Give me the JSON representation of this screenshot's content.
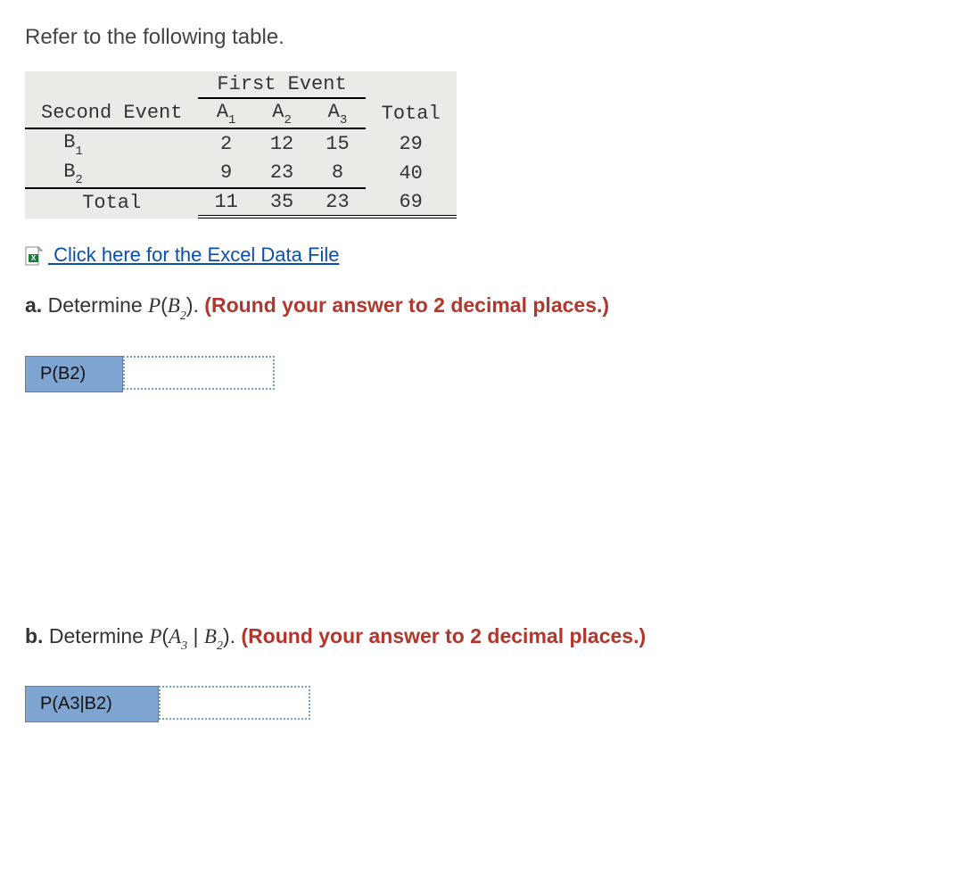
{
  "intro": "Refer to the following table.",
  "table": {
    "first_event_label": "First Event",
    "second_event_label": "Second Event",
    "total_label": "Total",
    "cols": {
      "a1": "A",
      "a1sub": "1",
      "a2": "A",
      "a2sub": "2",
      "a3": "A",
      "a3sub": "3"
    },
    "rows": {
      "b1": {
        "label": "B",
        "sub": "1",
        "a1": "2",
        "a2": "12",
        "a3": "15",
        "total": "29"
      },
      "b2": {
        "label": "B",
        "sub": "2",
        "a1": "9",
        "a2": "23",
        "a3": "8",
        "total": "40"
      }
    },
    "totals": {
      "a1": "11",
      "a2": "35",
      "a3": "23",
      "grand": "69"
    }
  },
  "link": {
    "text": " Click here for the Excel Data File"
  },
  "qa": {
    "prefix": "a.",
    "text": " Determine ",
    "prob": "P",
    "open": "(",
    "var": "B",
    "sub": "2",
    "close": ").",
    "hint": " (Round your answer to 2 decimal places.)",
    "answer_label": "P(B2)"
  },
  "qb": {
    "prefix": "b.",
    "text": " Determine ",
    "prob": "P",
    "open": "(",
    "var1": "A",
    "sub1": "3",
    "sep": " | ",
    "var2": "B",
    "sub2": "2",
    "close": ").",
    "hint": " (Round your answer to 2 decimal places.)",
    "answer_label": "P(A3|B2)"
  }
}
